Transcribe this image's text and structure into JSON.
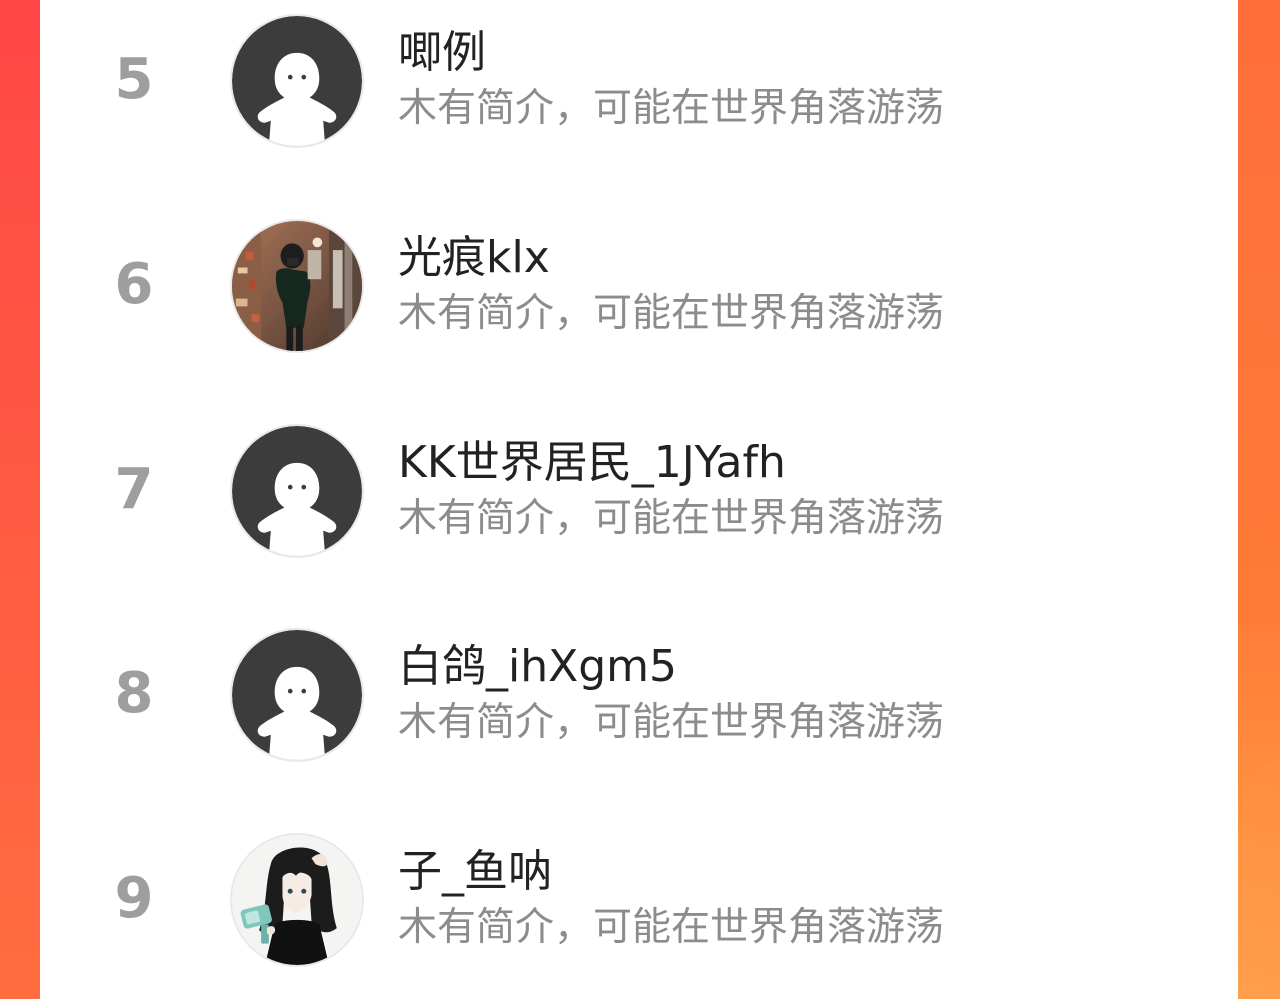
{
  "colors": {
    "accent_left": "#ff4747",
    "accent_right": "#ff7a36",
    "panel_bg": "#ffffff",
    "rank_text": "#9e9e9e",
    "name_text": "#222222",
    "bio_text": "#8c8c8c",
    "default_avatar": "#3c3c3c"
  },
  "ranking": {
    "items": [
      {
        "rank": "5",
        "name": "唧例",
        "bio": "木有简介，可能在世界角落游荡",
        "avatar": "default-avatar-icon"
      },
      {
        "rank": "6",
        "name": "光痕klx",
        "bio": "木有简介，可能在世界角落游荡",
        "avatar": "photo-person-street"
      },
      {
        "rank": "7",
        "name": "KK世界居民_1JYafh",
        "bio": "木有简介，可能在世界角落游荡",
        "avatar": "default-avatar-icon"
      },
      {
        "rank": "8",
        "name": "白鸽_ihXgm5",
        "bio": "木有简介，可能在世界角落游荡",
        "avatar": "default-avatar-icon"
      },
      {
        "rank": "9",
        "name": "子_鱼呐",
        "bio": "木有简介，可能在世界角落游荡",
        "avatar": "anime-girl-hairdryer"
      }
    ]
  }
}
